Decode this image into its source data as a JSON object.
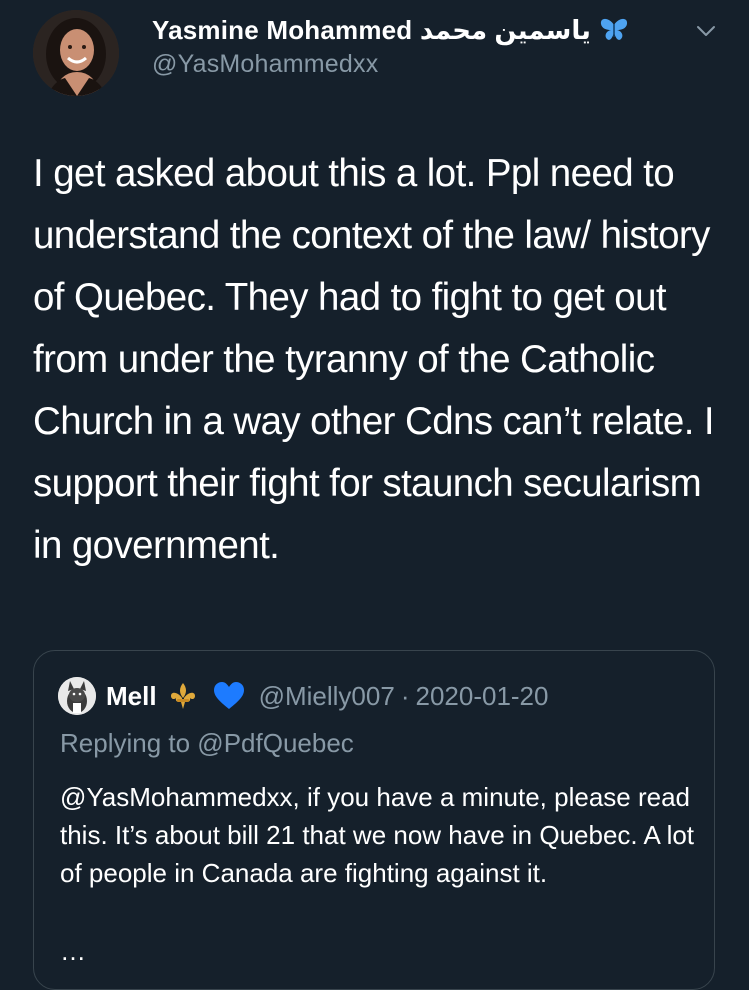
{
  "tweet": {
    "author": {
      "display_name": "Yasmine Mohammed ياسمين محمد",
      "badge_icon": "butterfly-icon",
      "handle": "@YasMohammedxx",
      "menu_icon": "chevron-down-icon"
    },
    "text": "I get asked about this a lot. Ppl need to understand the context of the law/ history of Quebec. They had to fight to get out from under the tyranny of the Catholic Church in a way other Cdns can’t relate. I support their fight for staunch secularism in government."
  },
  "quoted_tweet": {
    "display_name": "Mell",
    "emoji_icons": [
      "fleur-de-lis-icon",
      "blue-heart-icon"
    ],
    "handle": "@Mielly007",
    "separator": "·",
    "date": "2020-01-20",
    "replying_to": "Replying to @PdfQuebec",
    "text": "@YasMohammedxx, if you have a minute, please read this. It’s about bill 21 that we now have in Quebec. A lot of people in Canada are fighting against it.",
    "truncation": "…"
  },
  "colors": {
    "background": "#15202b",
    "primary_text": "#ffffff",
    "secondary_text": "#8899a6",
    "border": "#38444d",
    "heart": "#1d7bff",
    "butterfly": "#4ea3f1",
    "fleur": "#e0a93b"
  }
}
